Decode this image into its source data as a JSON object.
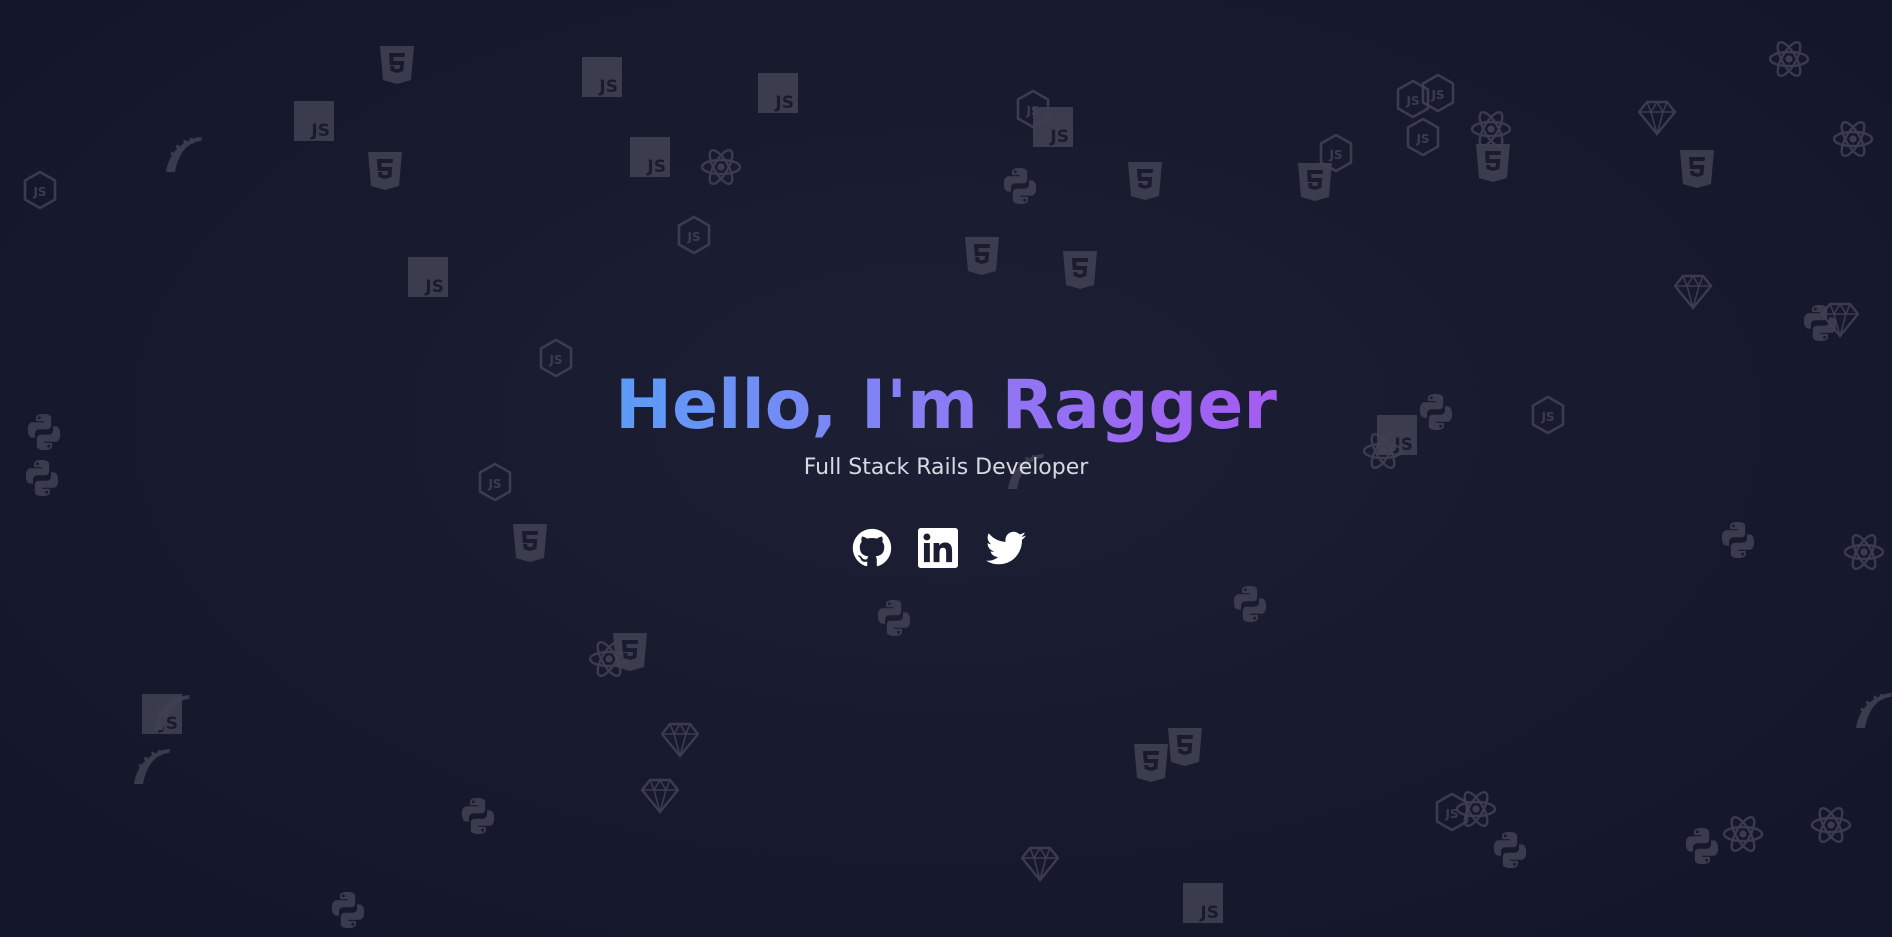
{
  "hero": {
    "title": "Hello, I'm Ragger",
    "subtitle": "Full Stack Rails Developer"
  },
  "social_links": [
    {
      "name": "GitHub",
      "icon": "github-icon"
    },
    {
      "name": "LinkedIn",
      "icon": "linkedin-icon"
    },
    {
      "name": "Twitter",
      "icon": "twitter-icon"
    }
  ],
  "background": {
    "icon_types": [
      "js-icon",
      "html5-icon",
      "css3-icon",
      "react-icon",
      "python-icon",
      "ruby-icon",
      "nodejs-icon",
      "rails-icon"
    ]
  },
  "colors": {
    "background": "#181a2d",
    "title_gradient_start": "#5b9cf6",
    "title_gradient_end": "#a55bf1",
    "subtitle": "#d8d9e3",
    "icon_faded": "#3f4152"
  }
}
